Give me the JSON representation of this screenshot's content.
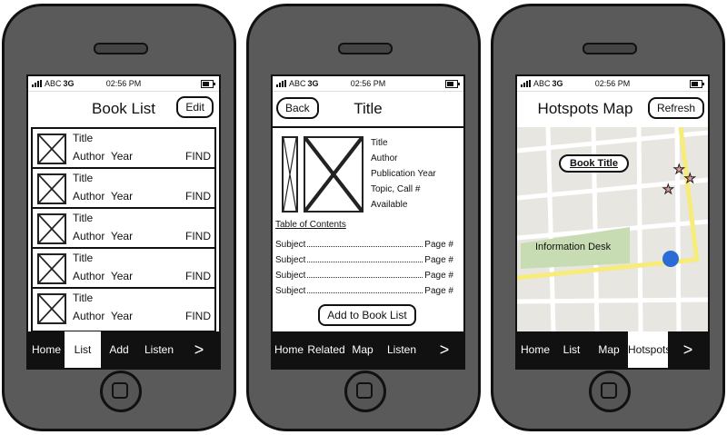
{
  "status_bar": {
    "carrier": "ABC",
    "network": "3G",
    "time": "02:56 PM"
  },
  "screens": {
    "list": {
      "title": "Book List",
      "edit_label": "Edit",
      "rows": [
        {
          "title": "Title",
          "author": "Author",
          "year": "Year",
          "find": "FIND"
        },
        {
          "title": "Title",
          "author": "Author",
          "year": "Year",
          "find": "FIND"
        },
        {
          "title": "Title",
          "author": "Author",
          "year": "Year",
          "find": "FIND"
        },
        {
          "title": "Title",
          "author": "Author",
          "year": "Year",
          "find": "FIND"
        },
        {
          "title": "Title",
          "author": "Author",
          "year": "Year",
          "find": "FIND"
        }
      ],
      "tabs": [
        "Home",
        "List",
        "Add",
        "Listen",
        ">"
      ],
      "active_tab": "List"
    },
    "detail": {
      "title": "Title",
      "back_label": "Back",
      "info": [
        "Title",
        "Author",
        "Publication Year",
        "Topic, Call #",
        "Available"
      ],
      "toc_title": "Table of Contents",
      "toc": [
        {
          "subject": "Subject",
          "page": "Page #"
        },
        {
          "subject": "Subject",
          "page": "Page #"
        },
        {
          "subject": "Subject",
          "page": "Page #"
        },
        {
          "subject": "Subject",
          "page": "Page #"
        }
      ],
      "add_label": "Add to Book List",
      "tabs": [
        "Home",
        "Related",
        "Map",
        "Listen",
        ">"
      ]
    },
    "map": {
      "title": "Hotspots Map",
      "refresh_label": "Refresh",
      "callout": "Book Title",
      "info_desk": "Information Desk",
      "tabs": [
        "Home",
        "List",
        "Map",
        "Hotspots",
        ">"
      ],
      "active_tab": "Hotspots"
    }
  },
  "colors": {
    "phone_body": "#5a5a5a",
    "map_bg": "#e8e6e1",
    "map_park": "#c8dcb4",
    "map_road_yellow": "#f7eb7a",
    "location_dot": "#2a6bd6",
    "star": "#e89a94"
  }
}
